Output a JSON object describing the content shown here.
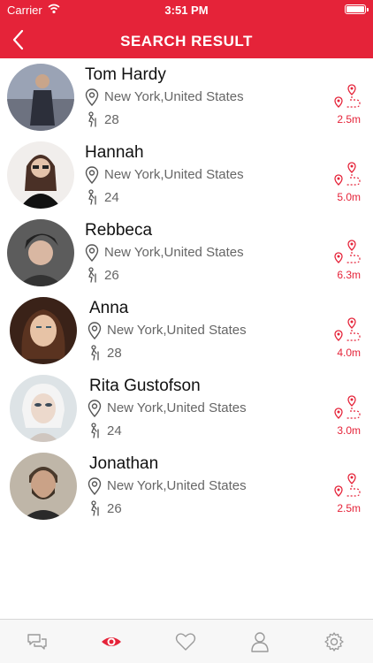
{
  "status_bar": {
    "carrier": "Carrier",
    "time": "3:51 PM"
  },
  "header": {
    "title": "SEARCH RESULT"
  },
  "accent_color": "#e52339",
  "results": [
    {
      "name": "Tom Hardy",
      "location": "New York,United States",
      "age": "28",
      "distance": "2.5m"
    },
    {
      "name": "Hannah",
      "location": "New York,United States",
      "age": "24",
      "distance": "5.0m"
    },
    {
      "name": "Rebbeca",
      "location": "New York,United States",
      "age": "26",
      "distance": "6.3m"
    },
    {
      "name": "Anna",
      "location": "New York,United States",
      "age": "28",
      "distance": "4.0m"
    },
    {
      "name": "Rita Gustofson",
      "location": "New York,United States",
      "age": "24",
      "distance": "3.0m"
    },
    {
      "name": "Jonathan",
      "location": "New York,United States",
      "age": "26",
      "distance": "2.5m"
    }
  ],
  "tabs": [
    {
      "icon": "chat-icon",
      "active": false
    },
    {
      "icon": "eye-icon",
      "active": true
    },
    {
      "icon": "heart-icon",
      "active": false
    },
    {
      "icon": "user-icon",
      "active": false
    },
    {
      "icon": "gear-icon",
      "active": false
    }
  ]
}
